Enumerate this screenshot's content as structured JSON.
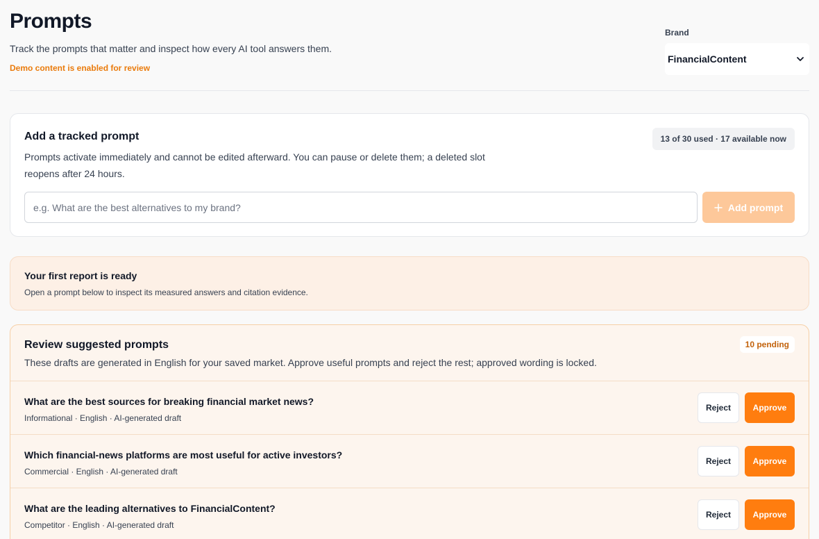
{
  "header": {
    "title": "Prompts",
    "subtitle": "Track the prompts that matter and inspect how every AI tool answers them.",
    "demo_note": "Demo content is enabled for review"
  },
  "brand": {
    "label": "Brand",
    "selected": "FinancialContent"
  },
  "add_prompt": {
    "title": "Add a tracked prompt",
    "description": "Prompts activate immediately and cannot be edited afterward. You can pause or delete them; a deleted slot reopens after 24 hours.",
    "usage": "13 of 30 used · 17 available now",
    "placeholder": "e.g. What are the best alternatives to my brand?",
    "button_label": "Add prompt"
  },
  "report": {
    "title": "Your first report is ready",
    "description": "Open a prompt below to inspect its measured answers and citation evidence."
  },
  "review": {
    "title": "Review suggested prompts",
    "description": "These drafts are generated in English for your saved market. Approve useful prompts and reject the rest; approved wording is locked.",
    "pending": "10 pending",
    "reject_label": "Reject",
    "approve_label": "Approve",
    "items": [
      {
        "title": "What are the best sources for breaking financial market news?",
        "meta": "Informational · English · AI-generated draft"
      },
      {
        "title": "Which financial-news platforms are most useful for active investors?",
        "meta": "Commercial · English · AI-generated draft"
      },
      {
        "title": "What are the leading alternatives to FinancialContent?",
        "meta": "Competitor · English · AI-generated draft"
      }
    ]
  },
  "colors": {
    "accent": "#ff7d0f",
    "accent_disabled": "#fdc89a",
    "demo_note": "#ea7b0c"
  }
}
